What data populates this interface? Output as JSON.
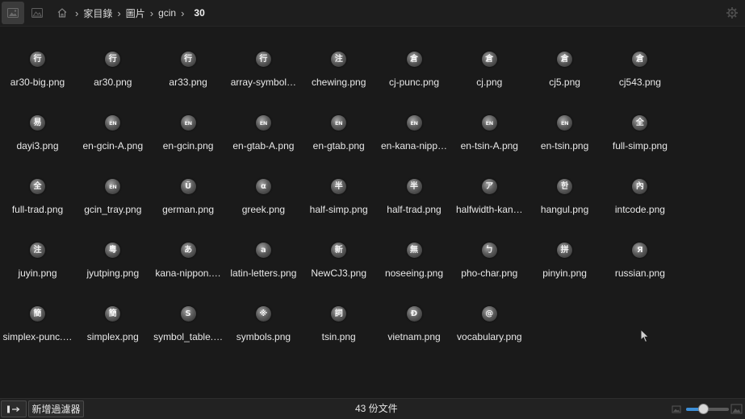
{
  "toolbar": {
    "view_icon": "gallery-view-icon",
    "image_icon": "image-icon",
    "home_icon": "home-icon",
    "settings_icon": "settings-icon"
  },
  "breadcrumb": {
    "separator": "›",
    "items": [
      "家目錄",
      "圖片",
      "gcin"
    ],
    "current": "30"
  },
  "file_icon": "image-thumbnail-icon",
  "files": [
    {
      "name": "ar30-big.png",
      "glyph": "行"
    },
    {
      "name": "ar30.png",
      "glyph": "行"
    },
    {
      "name": "ar33.png",
      "glyph": "行"
    },
    {
      "name": "array-symbol…",
      "glyph": "行"
    },
    {
      "name": "chewing.png",
      "glyph": "注"
    },
    {
      "name": "cj-punc.png",
      "glyph": "倉"
    },
    {
      "name": "cj.png",
      "glyph": "倉"
    },
    {
      "name": "cj5.png",
      "glyph": "倉"
    },
    {
      "name": "cj543.png",
      "glyph": "倉"
    },
    {
      "name": "dayi3.png",
      "glyph": "易"
    },
    {
      "name": "en-gcin-A.png",
      "glyph": "EN"
    },
    {
      "name": "en-gcin.png",
      "glyph": "EN"
    },
    {
      "name": "en-gtab-A.png",
      "glyph": "EN"
    },
    {
      "name": "en-gtab.png",
      "glyph": "EN"
    },
    {
      "name": "en-kana-nipp…",
      "glyph": "EN"
    },
    {
      "name": "en-tsin-A.png",
      "glyph": "EN"
    },
    {
      "name": "en-tsin.png",
      "glyph": "EN"
    },
    {
      "name": "full-simp.png",
      "glyph": "全"
    },
    {
      "name": "full-trad.png",
      "glyph": "全"
    },
    {
      "name": "gcin_tray.png",
      "glyph": "EN"
    },
    {
      "name": "german.png",
      "glyph": "Ü"
    },
    {
      "name": "greek.png",
      "glyph": "α"
    },
    {
      "name": "half-simp.png",
      "glyph": "半"
    },
    {
      "name": "half-trad.png",
      "glyph": "半"
    },
    {
      "name": "halfwidth-kan…",
      "glyph": "ア"
    },
    {
      "name": "hangul.png",
      "glyph": "한"
    },
    {
      "name": "intcode.png",
      "glyph": "內"
    },
    {
      "name": "juyin.png",
      "glyph": "注"
    },
    {
      "name": "jyutping.png",
      "glyph": "粵"
    },
    {
      "name": "kana-nippon.…",
      "glyph": "あ"
    },
    {
      "name": "latin-letters.png",
      "glyph": "a"
    },
    {
      "name": "NewCJ3.png",
      "glyph": "新"
    },
    {
      "name": "noseeing.png",
      "glyph": "無"
    },
    {
      "name": "pho-char.png",
      "glyph": "ㄅ"
    },
    {
      "name": "pinyin.png",
      "glyph": "拼"
    },
    {
      "name": "russian.png",
      "glyph": "Я"
    },
    {
      "name": "simplex-punc.…",
      "glyph": "簡"
    },
    {
      "name": "simplex.png",
      "glyph": "簡"
    },
    {
      "name": "symbol_table.…",
      "glyph": "S"
    },
    {
      "name": "symbols.png",
      "glyph": "※"
    },
    {
      "name": "tsin.png",
      "glyph": "詞"
    },
    {
      "name": "vietnam.png",
      "glyph": "Đ"
    },
    {
      "name": "vocabulary.png",
      "glyph": "@"
    }
  ],
  "statusbar": {
    "panel_toggle_icon": "sidebar-toggle-icon",
    "filter_button_label": "新增過濾器",
    "file_count": "43 份文件",
    "zoom_small_icon": "image-small-icon",
    "zoom_large_icon": "image-large-icon",
    "zoom_level": 0.4
  },
  "colors": {
    "accent": "#3d8fd8",
    "background": "#1b1b1b",
    "text": "#e6e6e6"
  }
}
